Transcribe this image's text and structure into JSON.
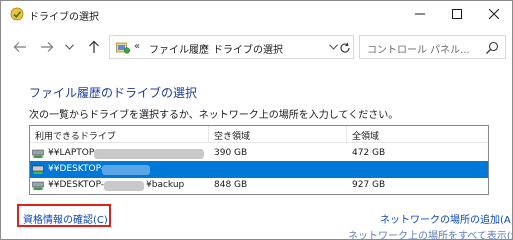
{
  "window": {
    "title": "ドライブの選択",
    "controls": {
      "minimize": "minimize-icon",
      "maximize": "maximize-icon",
      "close": "close-icon"
    }
  },
  "nav": {
    "back_icon": "arrow-left-icon",
    "forward_icon": "arrow-right-icon",
    "recent_icon": "chevron-down-icon",
    "up_icon": "arrow-up-icon",
    "address": {
      "separator": "«",
      "crumbs": [
        "ファイル履歴",
        "ドライブの選択"
      ],
      "crumb_separator": "›"
    },
    "search": {
      "placeholder": "コントロール パネル..."
    }
  },
  "main": {
    "heading": "ファイル履歴のドライブの選択",
    "instruction": "次の一覧からドライブを選択するか、ネットワーク上の場所を入力してください。",
    "columns": [
      "利用できるドライブ",
      "空き領域",
      "全領域"
    ],
    "drives": [
      {
        "name": "¥¥LAPTOP-",
        "free": "390 GB",
        "total": "472 GB",
        "selected": false
      },
      {
        "name": "¥¥DESKTOP-",
        "free": "",
        "total": "",
        "selected": true
      },
      {
        "name": "¥¥DESKTOP-",
        "name_suffix": "¥backup",
        "free": "848 GB",
        "total": "927 GB",
        "selected": false
      }
    ],
    "links": {
      "credentials": "資格情報の確認(C)",
      "add_network_location": "ネットワークの場所の追加(A)",
      "show_all_network": "ネットワーク上の場所をすべて表示(S)"
    }
  },
  "colors": {
    "heading": "#1e3c9c",
    "link": "#0a47b8",
    "selection": "#0078d7",
    "highlight_box": "#e0201b"
  }
}
